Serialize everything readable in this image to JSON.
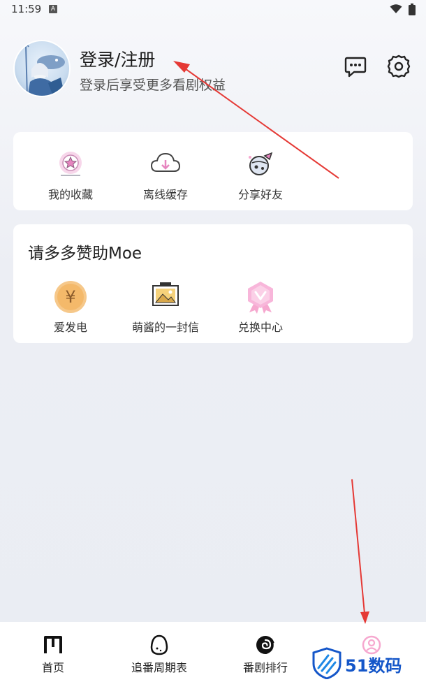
{
  "status_bar": {
    "time": "11:59",
    "badge": "A"
  },
  "profile": {
    "title": "登录/注册",
    "subtitle": "登录后享受更多看剧权益",
    "message_icon": "chat-bubble-icon",
    "settings_icon": "gear-icon"
  },
  "shortcuts": [
    {
      "label": "我的收藏",
      "icon": "favorite-star-icon"
    },
    {
      "label": "离线缓存",
      "icon": "cloud-download-icon"
    },
    {
      "label": "分享好友",
      "icon": "share-planet-icon"
    }
  ],
  "support": {
    "title": "请多多赞助Moe",
    "items": [
      {
        "label": "爱发电",
        "icon": "yen-coin-icon"
      },
      {
        "label": "萌酱的一封信",
        "icon": "letter-picture-icon"
      },
      {
        "label": "兑换中心",
        "icon": "exchange-badge-icon"
      }
    ]
  },
  "bottom_nav": [
    {
      "label": "首页",
      "icon": "home-m-icon"
    },
    {
      "label": "追番周期表",
      "icon": "egg-icon"
    },
    {
      "label": "番剧排行",
      "icon": "swirl-icon"
    },
    {
      "label": "",
      "icon": "profile-icon"
    }
  ],
  "watermark": {
    "text": "51数码"
  },
  "colors": {
    "accent_pink": "#f6a8cf",
    "arrow_red": "#e53935",
    "watermark_blue": "#1456c9"
  }
}
